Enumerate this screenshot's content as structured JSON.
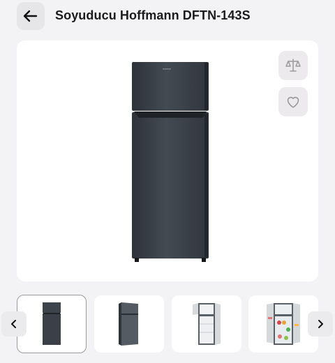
{
  "header": {
    "back_icon": "arrow-left-icon",
    "title": "Soyuducu Hoffmann DFTN-143S"
  },
  "main_image": {
    "alt": "Soyuducu Hoffmann DFTN-143S",
    "compare_icon": "scale-balance-icon",
    "favorite_icon": "heart-outline-icon"
  },
  "gallery": {
    "prev_icon": "chevron-left-icon",
    "next_icon": "chevron-right-icon",
    "thumbnails": [
      {
        "view": "front-closed",
        "selected": true
      },
      {
        "view": "angled-closed",
        "selected": false
      },
      {
        "view": "doors-open-empty",
        "selected": false
      },
      {
        "view": "doors-open-stocked",
        "selected": false
      }
    ]
  },
  "colors": {
    "background": "#f3f2f4",
    "card": "#ffffff",
    "button_bg": "#eceaed",
    "icon_gray": "#9a9a9a",
    "fridge_body": "#3a3f47"
  }
}
